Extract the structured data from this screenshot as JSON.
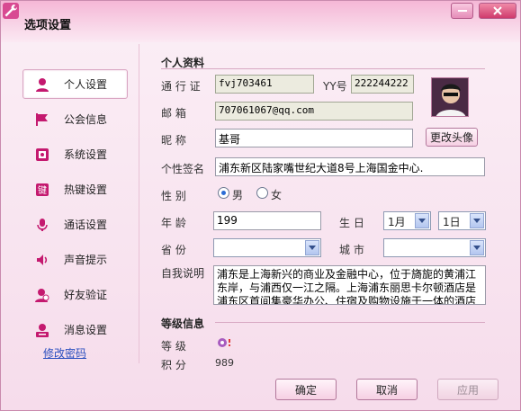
{
  "window": {
    "title": "选项设置"
  },
  "sidebar": {
    "items": [
      {
        "label": "个人设置",
        "icon": "person-icon",
        "active": true
      },
      {
        "label": "公会信息",
        "icon": "flag-icon"
      },
      {
        "label": "系统设置",
        "icon": "system-icon"
      },
      {
        "label": "热键设置",
        "icon": "hotkey-icon"
      },
      {
        "label": "通话设置",
        "icon": "microphone-icon"
      },
      {
        "label": "声音提示",
        "icon": "speaker-icon"
      },
      {
        "label": "好友验证",
        "icon": "friend-verify-icon"
      },
      {
        "label": "消息设置",
        "icon": "message-person-icon"
      }
    ],
    "change_password": "修改密码"
  },
  "profile": {
    "section_title": "个人资料",
    "passport_label": "通 行 证",
    "passport_value": "fvj703461",
    "yy_label": "YY号",
    "yy_value": "222244222",
    "email_label": "邮    箱",
    "email_value": "707061067@qq.com",
    "nickname_label": "昵    称",
    "nickname_value": "基哥",
    "change_avatar": "更改头像",
    "signature_label": "个性签名",
    "signature_value": "浦东新区陆家嘴世纪大道8号上海国金中心.",
    "gender_label": "性    别",
    "gender_options": [
      "男",
      "女"
    ],
    "gender_selected": "男",
    "age_label": "年    龄",
    "age_value": "199",
    "birthday_label": "生    日",
    "birth_month": "1月",
    "birth_day": "1日",
    "province_label": "省    份",
    "province_value": "",
    "city_label": "城    市",
    "city_value": "",
    "bio_label": "自我说明",
    "bio_value": "浦东是上海新兴的商业及金融中心，位于旖旎的黄浦江东岸，与浦西仅一江之隔。上海浦东丽思卡尔顿酒店是浦东区首间集豪华办公、住宿及购物设施于一体的酒店"
  },
  "level": {
    "section_title": "等级信息",
    "level_label": "等    级",
    "points_label": "积    分",
    "points_value": "989"
  },
  "buttons": {
    "ok": "确定",
    "cancel": "取消",
    "apply": "应用"
  },
  "colors": {
    "accent": "#d84a92",
    "link": "#2b4fbf"
  }
}
